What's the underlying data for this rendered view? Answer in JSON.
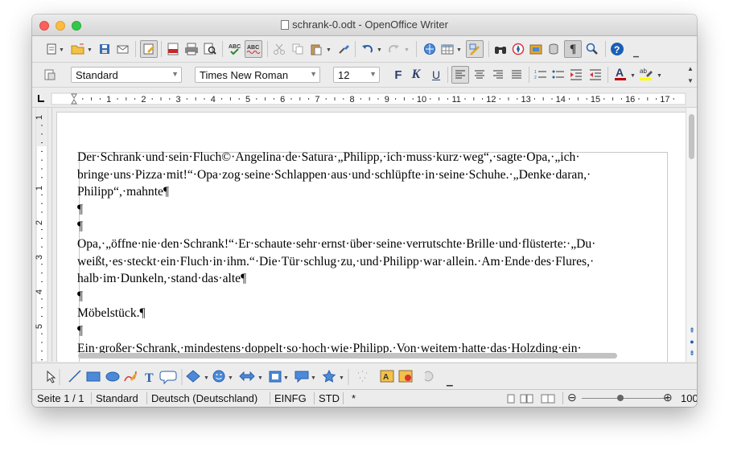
{
  "window": {
    "title": "schrank-0.odt - OpenOffice Writer"
  },
  "formatting": {
    "paragraph_style": "Standard",
    "font_name": "Times New Roman",
    "font_size": "12",
    "bold_glyph": "F",
    "italic_glyph": "K",
    "underline_glyph": "U"
  },
  "ruler": {
    "h_numbers": [
      "1",
      "2",
      "3",
      "4",
      "5",
      "6",
      "7",
      "8",
      "9",
      "10",
      "11",
      "12",
      "13",
      "14",
      "15",
      "16",
      "17"
    ],
    "v_numbers": [
      "1",
      "1",
      "2",
      "3",
      "4",
      "5"
    ]
  },
  "document": {
    "lines": [
      "Der·Schrank·und·sein·Fluch©·Angelina·de·Satura·„Philipp,·ich·muss·kurz·weg“,·sagte·Opa,·„ich·",
      "bringe·uns·Pizza·mit!“·Opa·zog·seine·Schlappen·aus·und·schlüpfte·in·seine·Schuhe.·„Denke·daran,·",
      "Philipp“,·mahnte¶",
      "¶",
      "¶",
      "Opa,·„öffne·nie·den·Schrank!“·Er·schaute·sehr·ernst·über·seine·verrutschte·Brille·und·flüsterte:·„Du·",
      "weißt,·es·steckt·ein·Fluch·in·ihm.“·Die·Tür·schlug·zu,·und·Philipp·war·allein.·Am·Ende·des·Flures,·",
      "halb·im·Dunkeln,·stand·das·alte¶",
      "¶",
      "Möbelstück.¶",
      "¶",
      "Ein·großer·Schrank,·mindestens·doppelt·so·hoch·wie·Philipp.·Von·weitem·hatte·das·Holzding·ein·"
    ]
  },
  "statusbar": {
    "page": "Seite 1 / 1",
    "style": "Standard",
    "language": "Deutsch (Deutschland)",
    "insert_mode": "EINFG",
    "selection_mode": "STD",
    "modified": "*",
    "zoom": "100"
  },
  "colors": {
    "font_color_bar": "#c00000",
    "highlight_bar": "#ffff00",
    "help_blue": "#1a5fb4"
  }
}
